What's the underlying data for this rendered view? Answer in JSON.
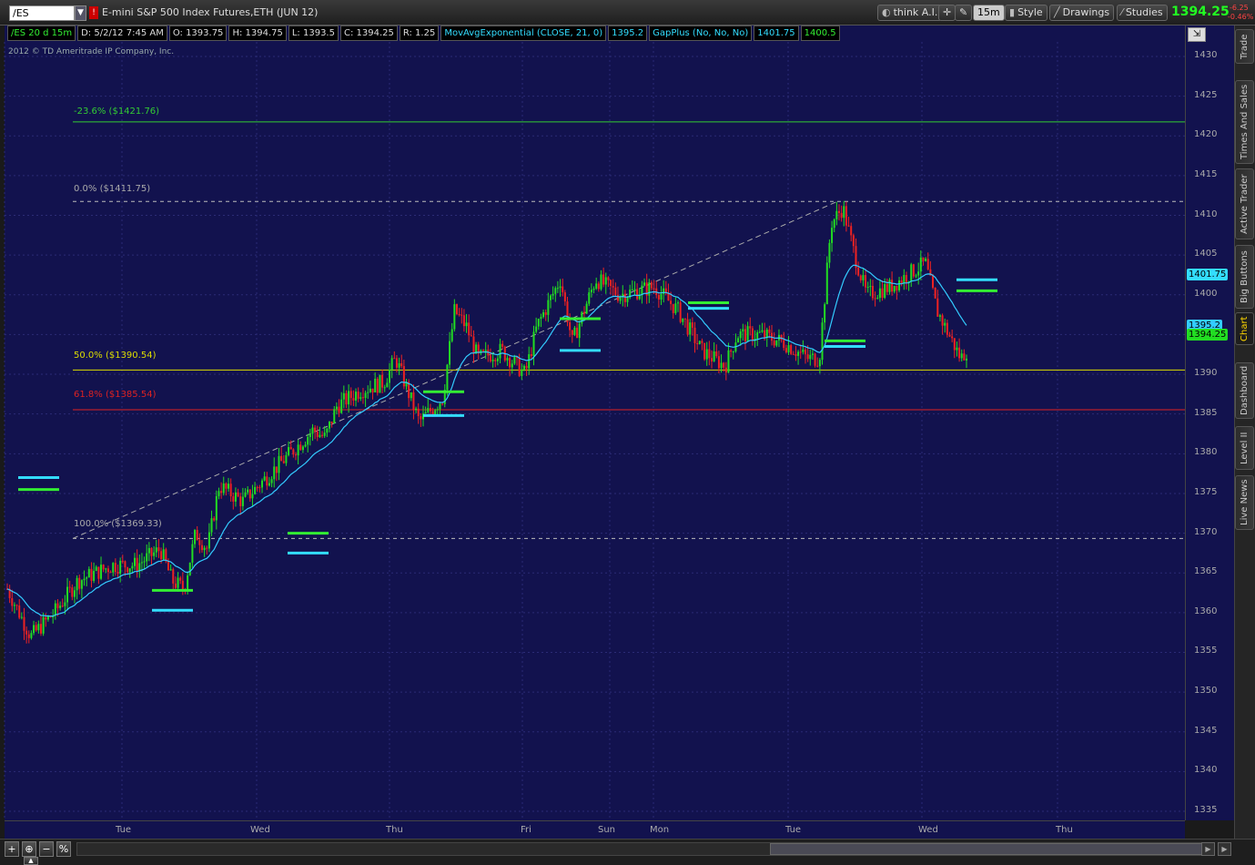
{
  "toolbar": {
    "symbol": "/ES",
    "badge": "!",
    "title": "E-mini S&P 500 Index Futures,ETH (JUN 12)",
    "think_label": "think A.I.",
    "interval_label": "15m",
    "style_label": "Style",
    "drawings_label": "Drawings",
    "studies_label": "Studies",
    "last_price": "1394.25",
    "change_abs": "-6.25",
    "change_pct": "-0.46%"
  },
  "infobar": {
    "chart_id": "/ES 20 d 15m",
    "date": "D: 5/2/12 7:45 AM",
    "open": "O: 1393.75",
    "high": "H: 1394.75",
    "low": "L: 1393.5",
    "close": "C: 1394.25",
    "range": "R: 1.25",
    "ma_study": "MovAvgExponential (CLOSE, 21, 0)",
    "ma_value": "1395.2",
    "gap_study": "GapPlus (No, No, No)",
    "gap_value1": "1401.75",
    "gap_value2": "1400.5"
  },
  "copyright": "2012 © TD Ameritrade IP Company, Inc.",
  "fib_labels": {
    "neg236": "-23.6%  ($1421.76)",
    "zero": "0.0%  ($1411.75)",
    "fifty": "50.0%  ($1390.54)",
    "sixtyone": "61.8%  ($1385.54)",
    "hundred": "100.0%  ($1369.33)"
  },
  "price_ticks": [
    "1430",
    "1425",
    "1420",
    "1415",
    "1410",
    "1405",
    "1400",
    "1395",
    "1390",
    "1385",
    "1380",
    "1375",
    "1370",
    "1365",
    "1360",
    "1355",
    "1350",
    "1345",
    "1340",
    "1335"
  ],
  "price_flags": {
    "gap_top": "1401.75",
    "ma": "1395.2",
    "last": "1394.25"
  },
  "time_ticks": [
    "Tue",
    "Wed",
    "Thu",
    "Fri",
    "Sun",
    "Mon",
    "Tue",
    "Wed",
    "Thu"
  ],
  "sidebar_tabs": [
    "Trade",
    "Times And Sales",
    "Active Trader",
    "Big Buttons",
    "Chart",
    "Dashboard",
    "Level II",
    "Live News"
  ],
  "bottom_buttons": [
    "+",
    "⊕",
    "−",
    "%"
  ],
  "colors": {
    "background": "#12124e",
    "bull": "#22dd22",
    "bear": "#ee2222",
    "ema": "#33ccff",
    "fib50": "#dddd00",
    "fib618": "#dd2222",
    "fib236": "#33cc33",
    "fib_grey": "#aaaaaa",
    "gap_cyan": "#33ddff",
    "gap_green": "#33ee33"
  },
  "chart_data": {
    "type": "candlestick",
    "ylim": [
      1335,
      1432
    ],
    "fib_levels": [
      {
        "level": "-23.6%",
        "price": 1421.76
      },
      {
        "level": "0.0%",
        "price": 1411.75
      },
      {
        "level": "50.0%",
        "price": 1390.54
      },
      {
        "level": "61.8%",
        "price": 1385.54
      },
      {
        "level": "100.0%",
        "price": 1369.33
      }
    ],
    "trend_line": {
      "start_price": 1369.33,
      "end_price": 1411.75
    },
    "gap_markers": [
      {
        "session": 0,
        "cyan": 1377,
        "green": 1375.5
      },
      {
        "session": 1,
        "cyan": 1360.3,
        "green": 1362.8
      },
      {
        "session": 2,
        "cyan": 1367.5,
        "green": 1370
      },
      {
        "session": 3,
        "cyan": 1384.8,
        "green": 1387.8
      },
      {
        "session": 4,
        "cyan": 1393,
        "green": 1397
      },
      {
        "session": 5,
        "cyan": 1398.3,
        "green": 1399
      },
      {
        "session": 6,
        "cyan": 1393.5,
        "green": 1394.2
      },
      {
        "session": 7,
        "cyan": 1401.9,
        "green": 1400.5
      }
    ],
    "price_path": [
      [
        0,
        1363
      ],
      [
        0.02,
        1357
      ],
      [
        0.04,
        1360
      ],
      [
        0.06,
        1364
      ],
      [
        0.09,
        1366
      ],
      [
        0.11,
        1366
      ],
      [
        0.13,
        1368
      ],
      [
        0.14,
        1364
      ],
      [
        0.15,
        1363
      ],
      [
        0.16,
        1370
      ],
      [
        0.17,
        1368
      ],
      [
        0.18,
        1376
      ],
      [
        0.2,
        1374
      ],
      [
        0.22,
        1377
      ],
      [
        0.24,
        1380
      ],
      [
        0.26,
        1383
      ],
      [
        0.27,
        1382
      ],
      [
        0.28,
        1386
      ],
      [
        0.3,
        1388
      ],
      [
        0.32,
        1389
      ],
      [
        0.33,
        1392
      ],
      [
        0.35,
        1384
      ],
      [
        0.37,
        1387
      ],
      [
        0.38,
        1398
      ],
      [
        0.39,
        1396
      ],
      [
        0.4,
        1392
      ],
      [
        0.42,
        1393
      ],
      [
        0.44,
        1390
      ],
      [
        0.45,
        1396
      ],
      [
        0.47,
        1402
      ],
      [
        0.48,
        1394
      ],
      [
        0.5,
        1402
      ],
      [
        0.52,
        1400
      ],
      [
        0.55,
        1401
      ],
      [
        0.57,
        1398
      ],
      [
        0.59,
        1393
      ],
      [
        0.61,
        1391
      ],
      [
        0.62,
        1395
      ],
      [
        0.64,
        1395
      ],
      [
        0.66,
        1394
      ],
      [
        0.68,
        1392
      ],
      [
        0.69,
        1392
      ],
      [
        0.7,
        1409
      ],
      [
        0.71,
        1411
      ],
      [
        0.72,
        1405
      ],
      [
        0.73,
        1400
      ],
      [
        0.75,
        1401
      ],
      [
        0.77,
        1403
      ],
      [
        0.78,
        1404
      ],
      [
        0.79,
        1398
      ],
      [
        0.81,
        1392
      ],
      [
        0.815,
        1393
      ]
    ]
  }
}
